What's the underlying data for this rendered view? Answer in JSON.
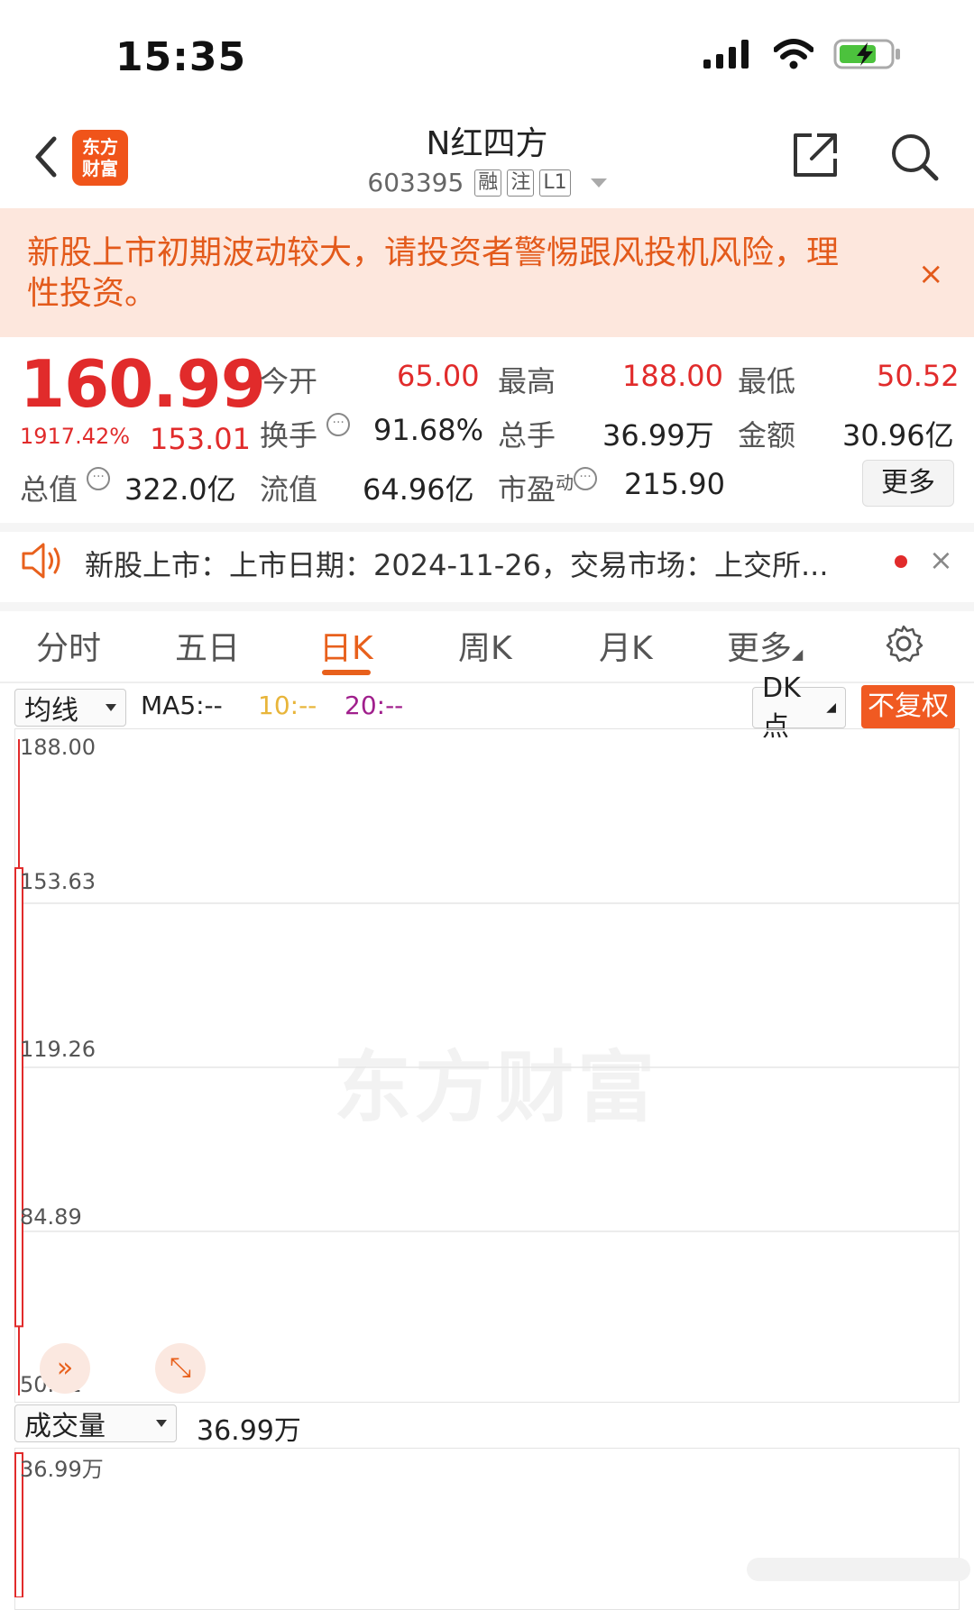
{
  "status_bar": {
    "time": "15:35"
  },
  "header": {
    "logo_line1": "东方",
    "logo_line2": "财富",
    "stock_name": "N红四方",
    "stock_code": "603395",
    "tags": [
      "融",
      "注",
      "L1"
    ]
  },
  "banner": {
    "text": "新股上市初期波动较大，请投资者警惕跟风投机风险，理性投资。",
    "close": "×"
  },
  "quote": {
    "price": "160.99",
    "change_pct": "1917.42%",
    "change": "153.01",
    "open_label": "今开",
    "open": "65.00",
    "high_label": "最高",
    "high": "188.00",
    "low_label": "最低",
    "low": "50.52",
    "turnover_label": "换手",
    "turnover": "91.68%",
    "volume_label": "总手",
    "volume": "36.99万",
    "amount_label": "金额",
    "amount": "30.96亿",
    "mktcap_label": "总值",
    "mktcap": "322.0亿",
    "float_label": "流值",
    "float": "64.96亿",
    "pe_label": "市盈",
    "pe_sup": "动",
    "pe": "215.90",
    "more": "更多"
  },
  "news": {
    "text": "新股上市：上市日期：2024-11-26，交易市场：上交所...",
    "close": "×"
  },
  "tabs": [
    {
      "label": "分时"
    },
    {
      "label": "五日"
    },
    {
      "label": "日K"
    },
    {
      "label": "周K"
    },
    {
      "label": "月K"
    },
    {
      "label": "更多"
    }
  ],
  "active_tab": "日K",
  "chart_toolbar": {
    "indicator": "均线",
    "ma5": "MA5:--",
    "ma10": "10:--",
    "ma20": "20:--",
    "dk": "DK点",
    "fuquan": "不复权"
  },
  "chart_data": {
    "type": "candlestick",
    "y_ticks": [
      "188.00",
      "153.63",
      "119.26",
      "84.89",
      "50.52"
    ],
    "ylim": [
      50.52,
      188.0
    ],
    "candles": [
      {
        "open": 65.0,
        "high": 188.0,
        "low": 50.52,
        "close": 160.99
      }
    ],
    "volume_indicator": "成交量",
    "volume_value": "36.99万",
    "volume_axis_max": "36.99万",
    "watermark": "东方财富"
  },
  "colors": {
    "up": "#e12b2b",
    "accent": "#e8601c",
    "banner_bg": "#fde7dd"
  }
}
